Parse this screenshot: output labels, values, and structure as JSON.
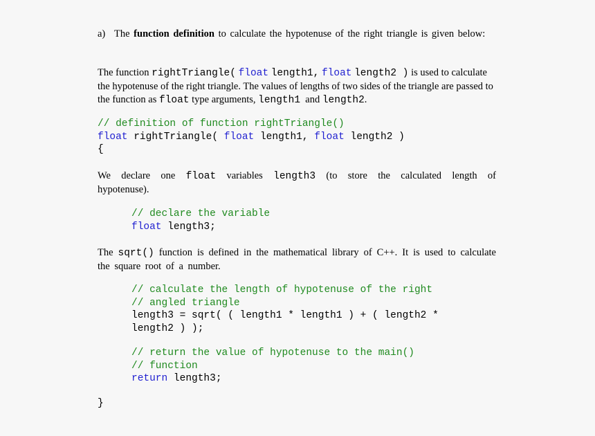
{
  "item_a": {
    "marker": "a)",
    "pre": "The ",
    "bold": "function definition",
    "post": " to calculate the hypotenuse of the right triangle is given below:"
  },
  "para1": {
    "t1": "The function ",
    "c1": "rightTriangle(",
    "k1": "float",
    "c2": "length1,",
    "k2": "float",
    "c3": "length2 )",
    "t2": " is used to calculate the hypotenuse of the right triangle. The values of lengths of two sides of the triangle are passed to the function as ",
    "c4": "float",
    "t3": " type arguments, ",
    "c5": "length1",
    "t4": "  and ",
    "c6": "length2",
    "t5": "."
  },
  "code1": {
    "comment": "// definition of function rightTriangle()",
    "kw1": "float",
    "txt1": " rightTriangle( ",
    "kw2": "float",
    "txt2": " length1, ",
    "kw3": "float",
    "txt3": " length2 )",
    "brace_open": "{"
  },
  "para2": {
    "t1": "We declare one ",
    "c1": "float",
    "t2": " variables ",
    "c2": "length3",
    "t3": " (to store the calculated length of hypotenuse)."
  },
  "code2": {
    "comment": "// declare the variable",
    "kw": "float",
    "txt": " length3;"
  },
  "para3": {
    "t1": "The ",
    "c1": "sqrt()",
    "t2": " function is defined in the mathematical library of C++. It is used to calculate the square root of a number."
  },
  "code3": {
    "comment1": "// calculate the length of hypotenuse of the right",
    "comment2": "// angled triangle",
    "line1": "length3 = sqrt( ( length1 * length1 ) + ( length2 *",
    "line2": "length2 ) );"
  },
  "code4": {
    "comment1": "// return the value of hypotenuse to the main()",
    "comment2": "// function",
    "kw": "return",
    "txt": " length3;",
    "brace_close": "}"
  }
}
